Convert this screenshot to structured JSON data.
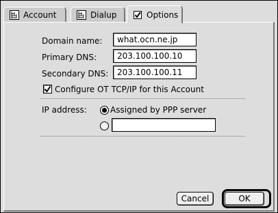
{
  "tabs": [
    {
      "label": "Account",
      "icon": "network-icon",
      "active": false
    },
    {
      "label": "Dialup",
      "icon": "network-icon",
      "active": false
    },
    {
      "label": "Options",
      "icon": "checkbox-checked-icon",
      "active": true
    }
  ],
  "form": {
    "domain_label": "Domain name:",
    "domain_value": "what.ocn.ne.jp",
    "primary_dns_label": "Primary DNS:",
    "primary_dns_value": "203.100.100.10",
    "secondary_dns_label": "Secondary DNS:",
    "secondary_dns_value": "203.100.100.11",
    "configure_label": "Configure OT TCP/IP for this Account",
    "configure_checked": true,
    "ip_label": "IP address:",
    "ip_option_assigned": "Assigned by PPP server",
    "ip_option_manual_value": "",
    "ip_selected": "assigned"
  },
  "buttons": {
    "cancel": "Cancel",
    "ok": "OK"
  }
}
